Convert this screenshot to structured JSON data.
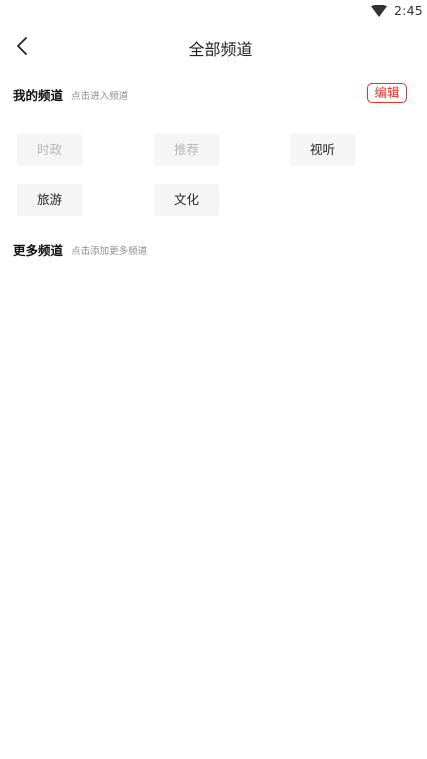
{
  "status_bar": {
    "time": "2:45",
    "icons": [
      "wifi-icon"
    ]
  },
  "nav": {
    "title": "全部频道",
    "back_icon": "chevron-left-icon"
  },
  "my_channels": {
    "title": "我的频道",
    "hint": "点击进入频道",
    "edit_label": "编辑",
    "items": [
      {
        "label": "时政",
        "fixed": true
      },
      {
        "label": "推荐",
        "fixed": true
      },
      {
        "label": "视听",
        "fixed": false
      },
      {
        "label": "旅游",
        "fixed": false
      },
      {
        "label": "文化",
        "fixed": false
      }
    ]
  },
  "more_channels": {
    "title": "更多频道",
    "hint": "点击添加更多频道",
    "items": []
  },
  "colors": {
    "accent": "#e0352b",
    "chip_background": "#f5f5f5",
    "fixed_chip_text": "#b6b6b6",
    "hint_text": "#8e8e8e"
  }
}
